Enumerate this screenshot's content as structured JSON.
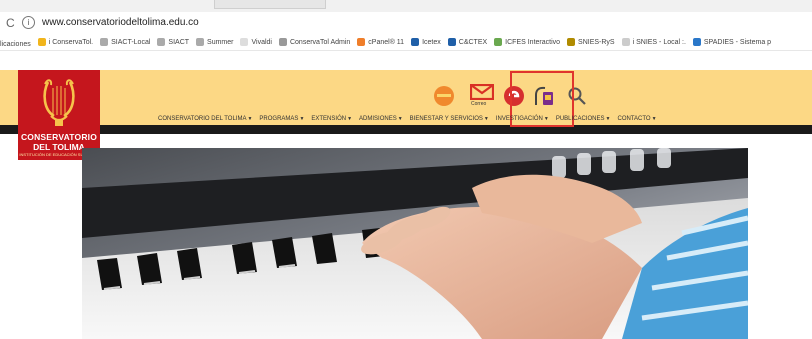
{
  "browser": {
    "reload_glyph": "C",
    "info_glyph": "i",
    "url": "www.conservatoriodeltolima.edu.co"
  },
  "bookmarks": [
    {
      "label": "licaciones",
      "color": "transparent"
    },
    {
      "label": "i ConservaTol.",
      "color": "#f1b51c"
    },
    {
      "label": "SIACT-Local",
      "color": "#aaaaaa"
    },
    {
      "label": "SIACT",
      "color": "#aaaaaa"
    },
    {
      "label": "Summer",
      "color": "#aaaaaa"
    },
    {
      "label": "Vivaldi",
      "color": "#dddddd"
    },
    {
      "label": "ConservaTol Admin",
      "color": "#999999"
    },
    {
      "label": "cPanel® 11",
      "color": "#ef7e2a"
    },
    {
      "label": "Icetex",
      "color": "#1f5fa8"
    },
    {
      "label": "C&CTEX",
      "color": "#1f5fa8"
    },
    {
      "label": "ICFES Interactivo",
      "color": "#6aa84f"
    },
    {
      "label": "SNIES-RyS",
      "color": "#b08b00"
    },
    {
      "label": "i SNIES - Local :.",
      "color": "#cccccc"
    },
    {
      "label": "SPADIES - Sistema p",
      "color": "#2a77c9"
    }
  ],
  "logo": {
    "line1": "CONSERVATORIO",
    "line2": "DEL TOLIMA",
    "line3": "INSTITUCIÓN DE EDUCACIÓN SUPERIOR"
  },
  "header_icons": {
    "correo_label": "Correo"
  },
  "menu": [
    "CONSERVATORIO DEL TOLIMA",
    "PROGRAMAS",
    "EXTENSIÓN",
    "ADMISIONES",
    "BIENESTAR Y SERVICIOS",
    "INVESTIGACIÓN",
    "PUBLICACIONES",
    "CONTACTO"
  ],
  "colors": {
    "header_bg": "#fcd885",
    "logo_red": "#c5161d",
    "highlight_red": "#e0342d"
  }
}
